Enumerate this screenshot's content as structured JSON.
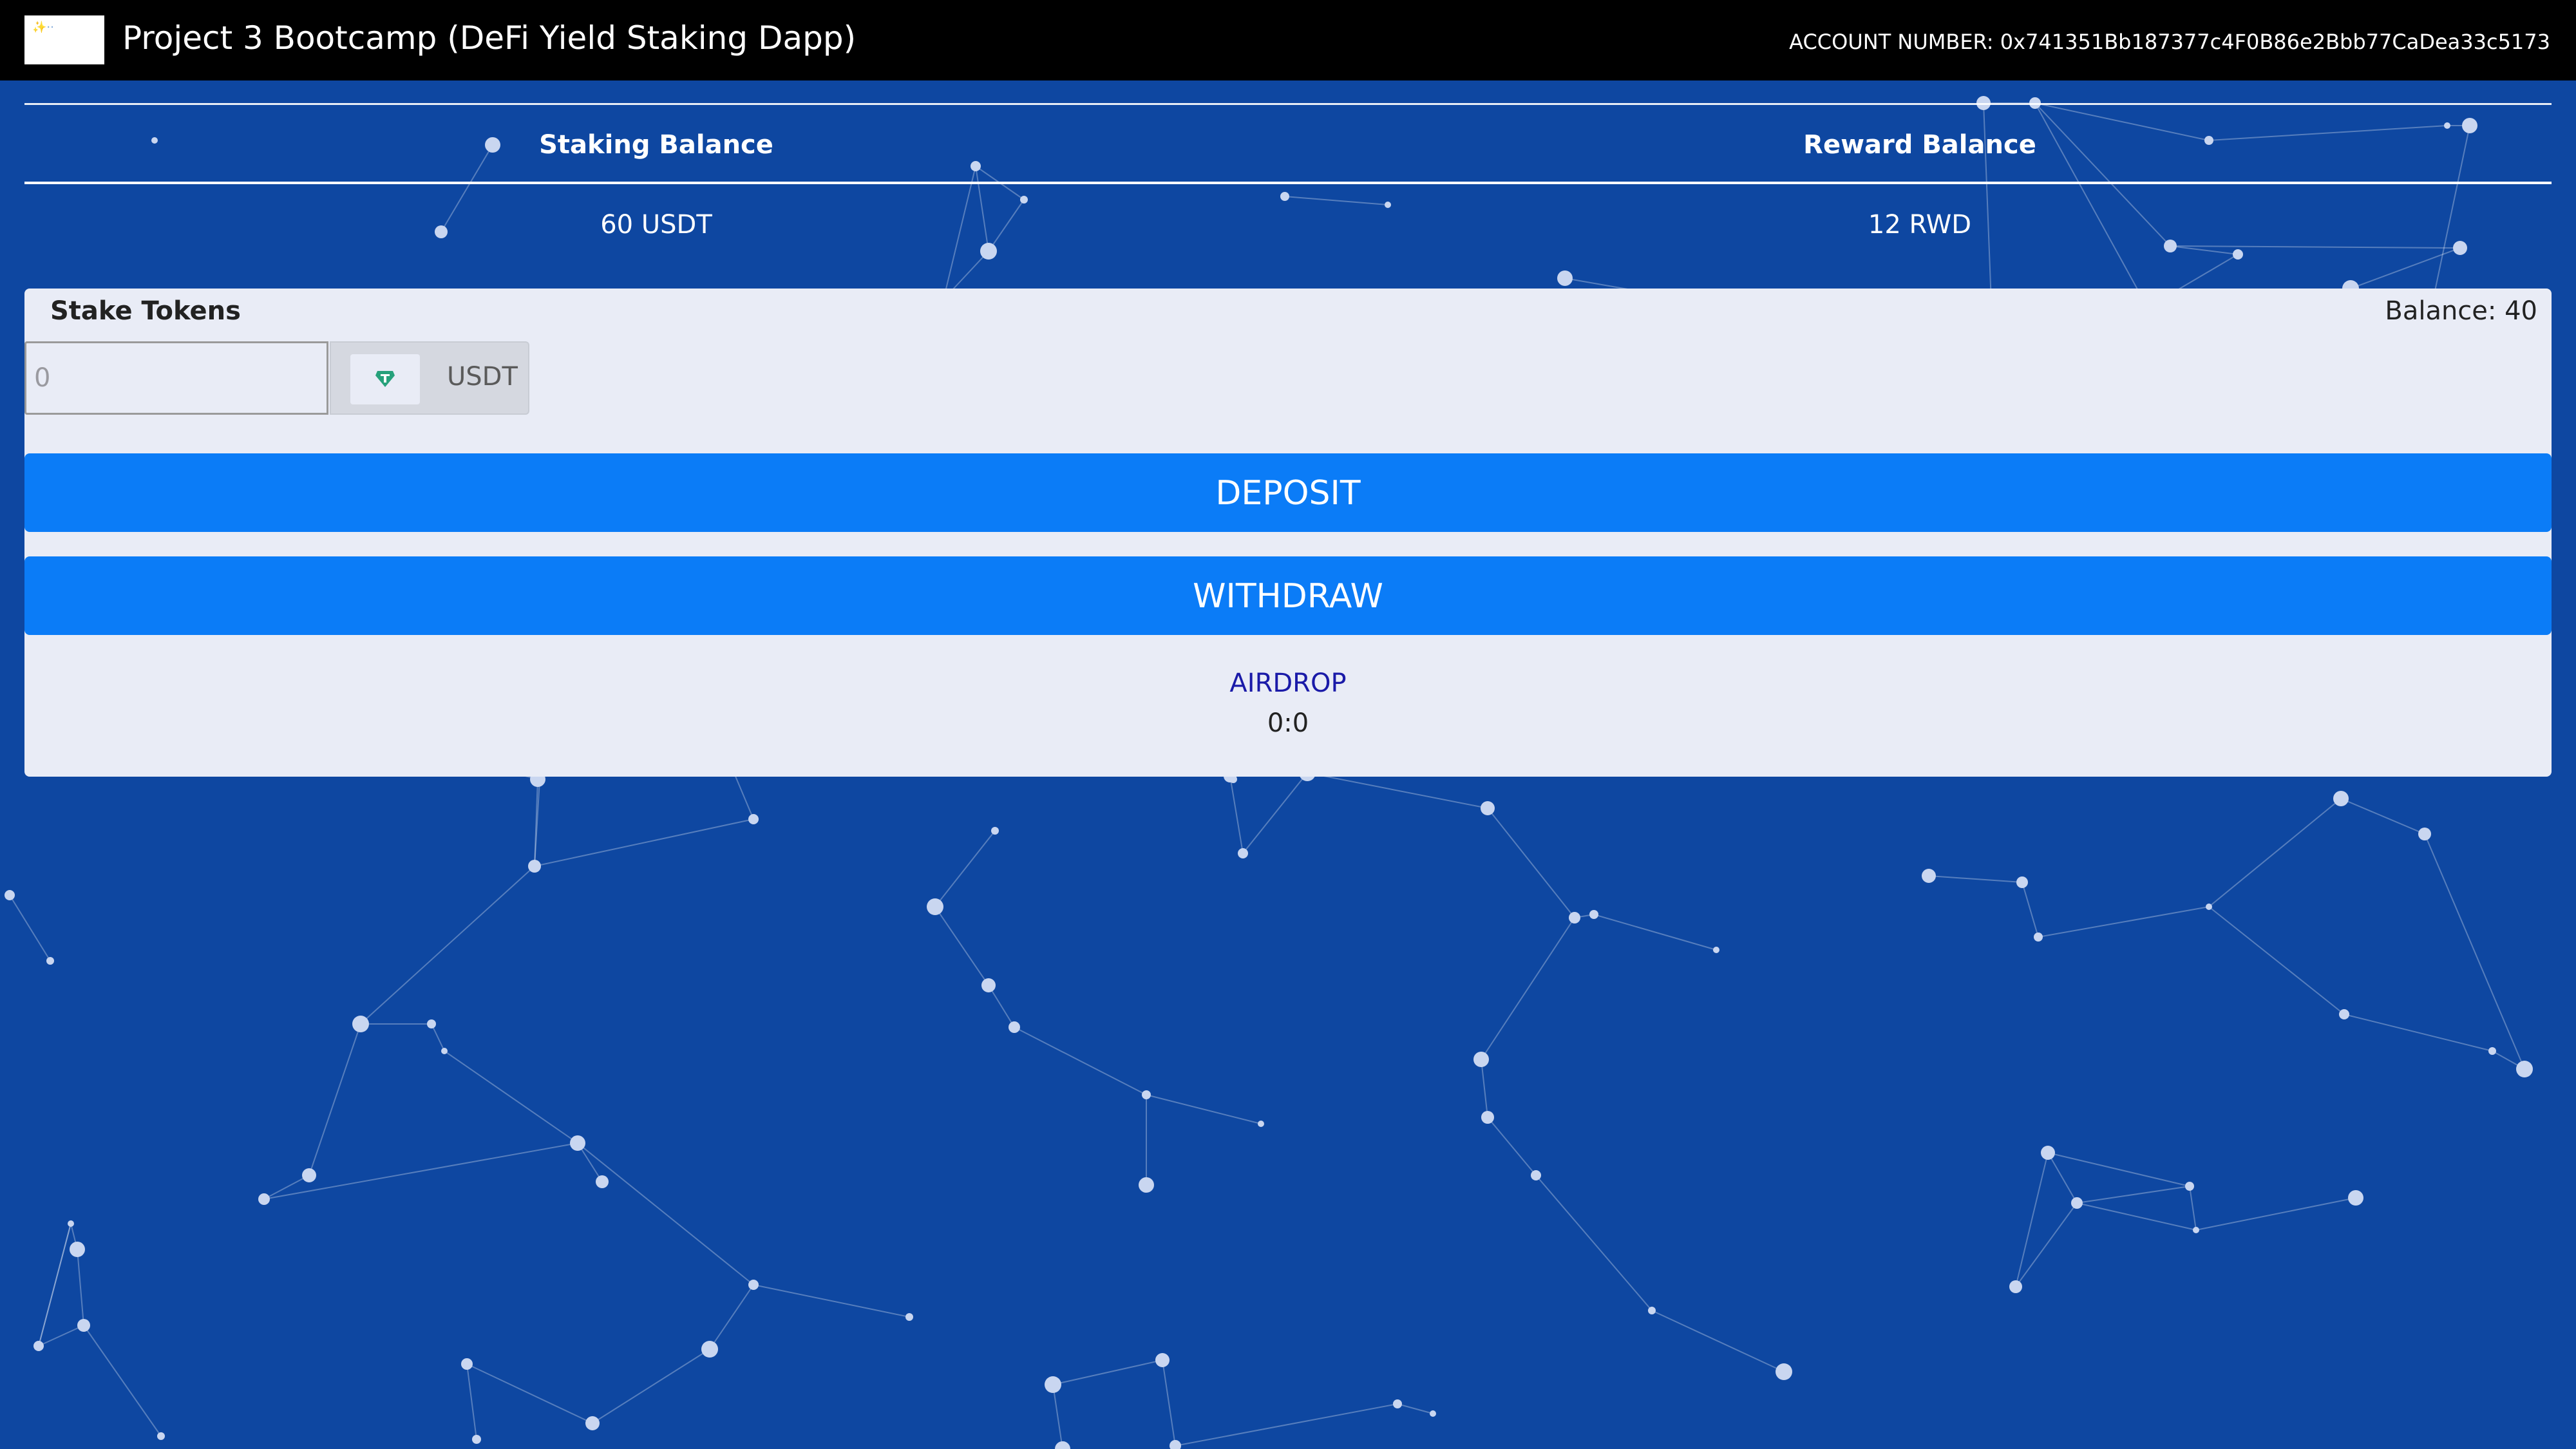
{
  "navbar": {
    "logo_text": "✨··",
    "title": "Project 3 Bootcamp (DeFi Yield Staking Dapp)",
    "account_label": "ACCOUNT NUMBER:",
    "account_number": "0x741351Bb187377c4F0B86e2Bbb77CaDea33c5173"
  },
  "balances": {
    "staking_header": "Staking Balance",
    "reward_header": "Reward Balance",
    "staking_value": "60 USDT",
    "reward_value": "12 RWD"
  },
  "stake_card": {
    "title": "Stake Tokens",
    "balance_text": "Balance: 40",
    "amount_placeholder": "0",
    "token_symbol": "USDT",
    "token_icon": "tether-gem-icon",
    "deposit_label": "DEPOSIT",
    "withdraw_label": "WITHDRAW",
    "airdrop_label": "AIRDROP",
    "airdrop_timer": "0:0"
  },
  "colors": {
    "background": "#0e47a1",
    "navbar": "#000000",
    "card": "#e9ecf6",
    "button": "#0b7cf7",
    "airdrop_link": "#1a1aa8",
    "token_icon": "#26a17b"
  },
  "background_decoration": "particle-network"
}
